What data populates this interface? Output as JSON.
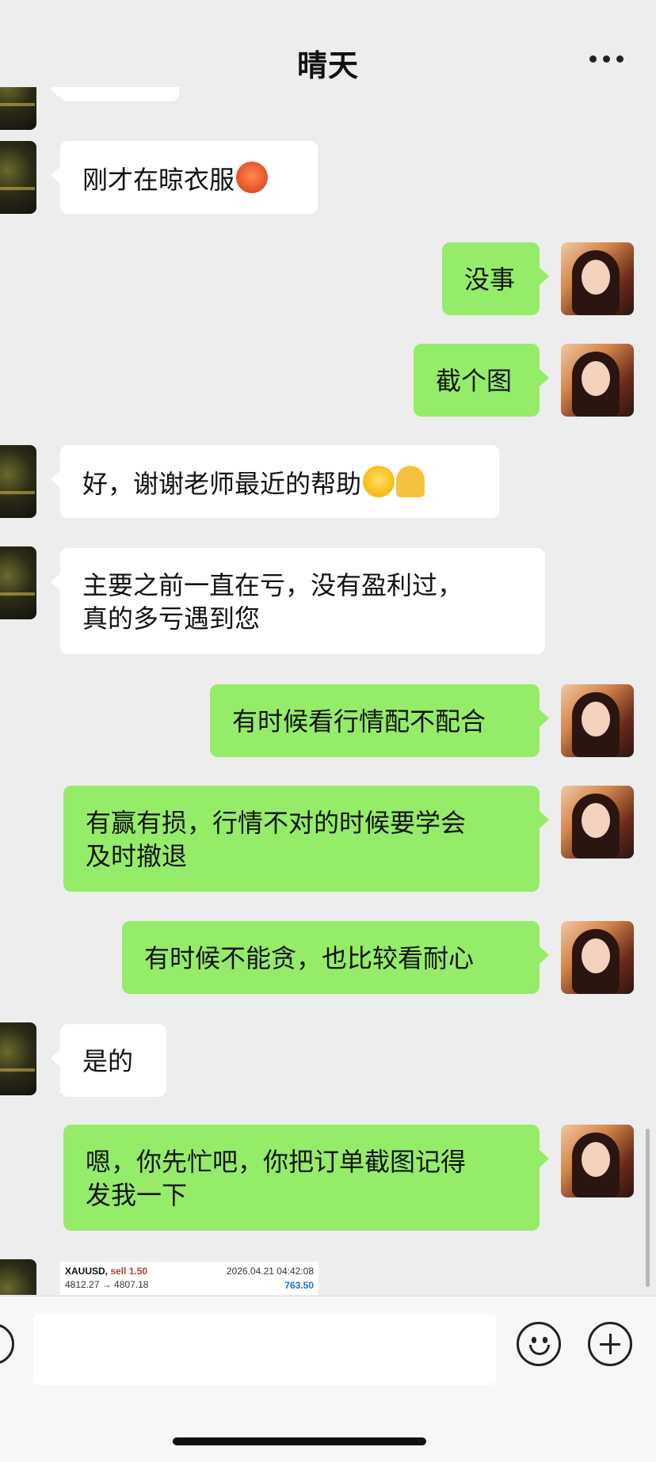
{
  "header": {
    "title": "晴天",
    "more_icon": "more-dots-icon"
  },
  "messages": [
    {
      "dir": "in",
      "text": "刚才在晾衣服",
      "emoji": "sweat-face"
    },
    {
      "dir": "out",
      "text": "没事"
    },
    {
      "dir": "out",
      "text": "截个图"
    },
    {
      "dir": "in",
      "text": "好，谢谢老师最近的帮助",
      "emoji": "grin-face pray-hands"
    },
    {
      "dir": "in",
      "text": "主要之前一直在亏，没有盈利过，\n真的多亏遇到您"
    },
    {
      "dir": "out",
      "text": "有时候看行情配不配合"
    },
    {
      "dir": "out",
      "text": "有赢有损，行情不对的时候要学会\n及时撤退"
    },
    {
      "dir": "out",
      "text": "有时候不能贪，也比较看耐心"
    },
    {
      "dir": "in",
      "text": "是的"
    },
    {
      "dir": "out",
      "text": "嗯，你先忙吧，你把订单截图记得\n发我一下"
    }
  ],
  "trade_card": {
    "symbol": "XAUUSD,",
    "side": "sell 1.50",
    "datetime": "2026.04.21 04:42:08",
    "prices": "4812.27 → 4807.18",
    "profit": "763.50"
  },
  "input_bar": {
    "voice_icon": "voice-icon",
    "emoji_icon": "emoji-icon",
    "plus_icon": "plus-icon"
  }
}
